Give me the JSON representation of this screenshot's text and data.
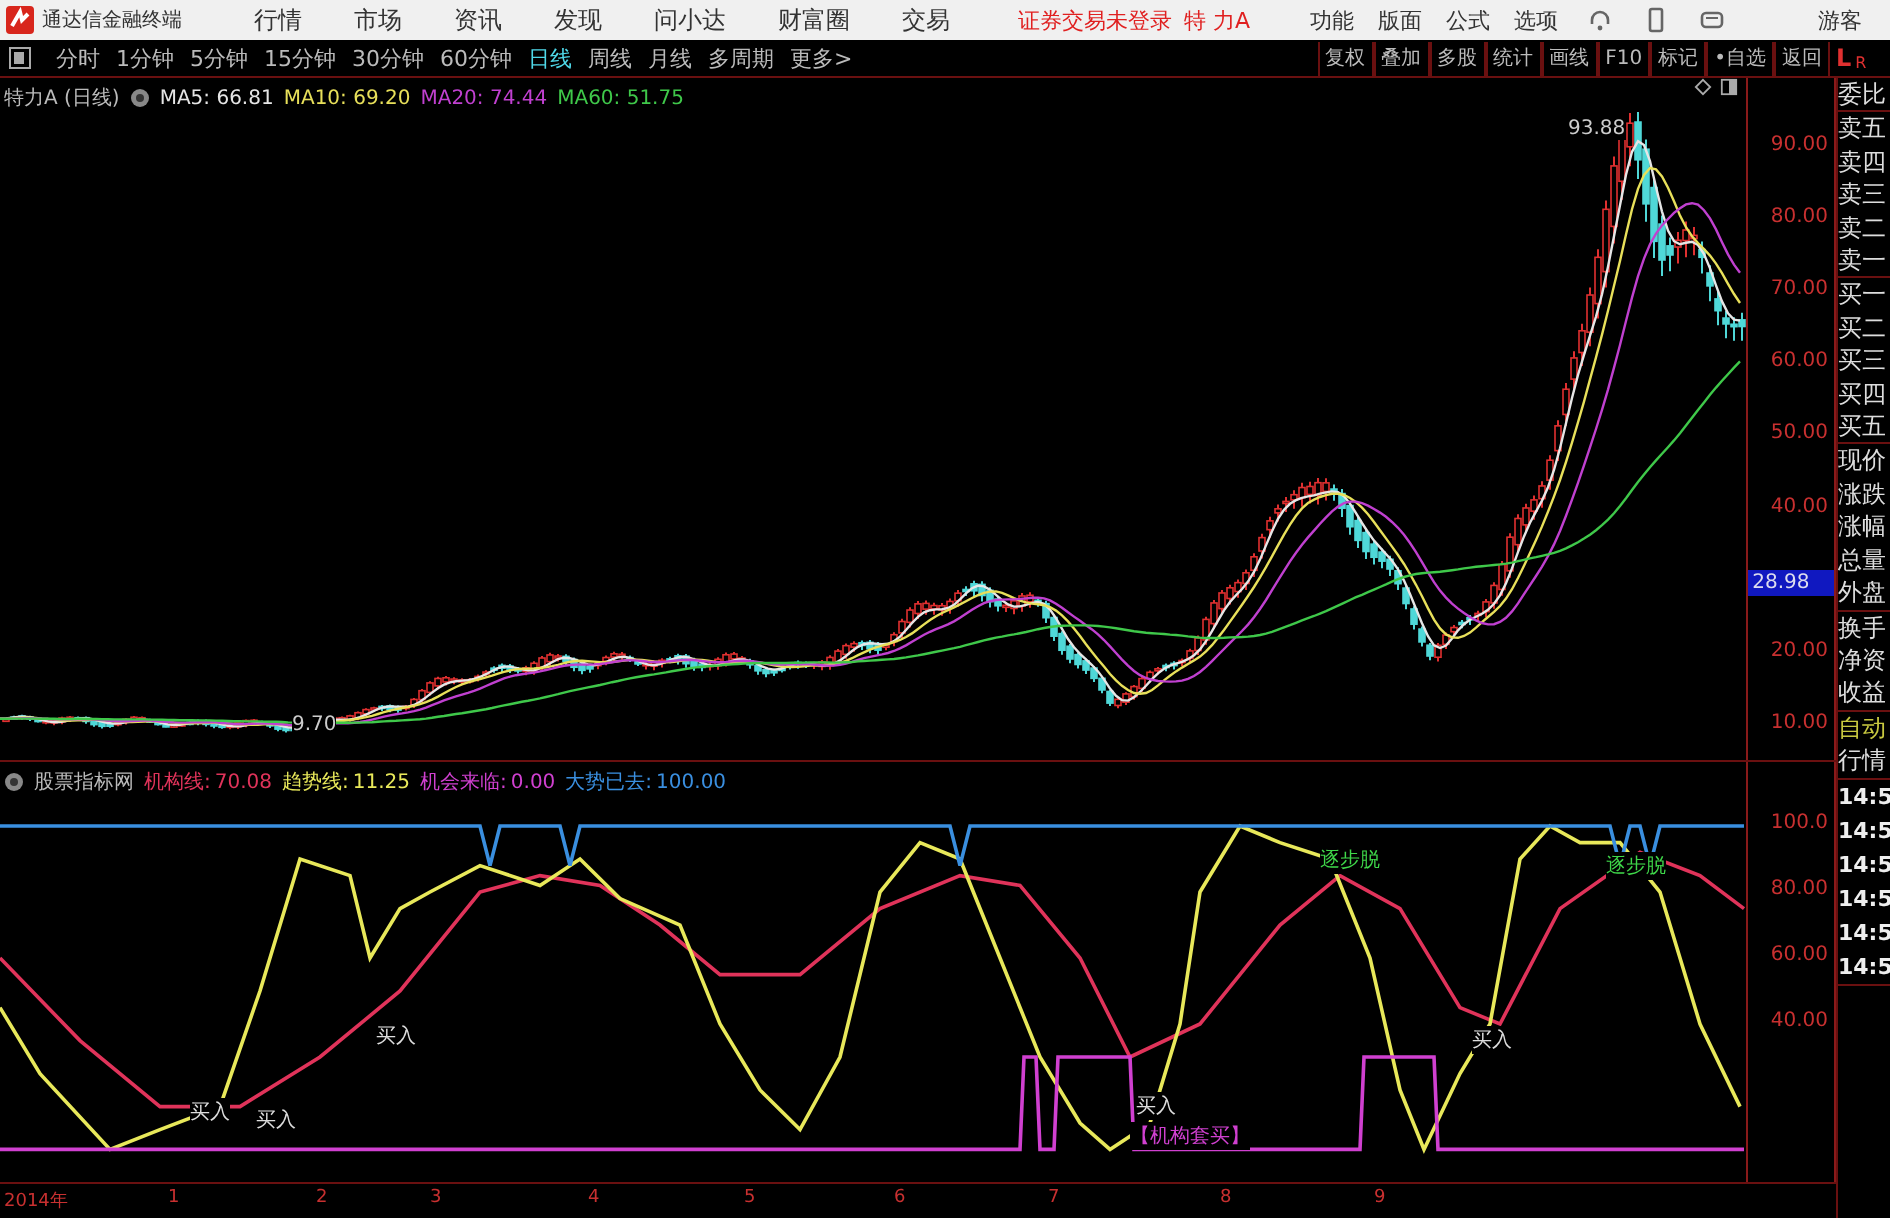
{
  "app_title": "通达信金融终端",
  "menu": [
    "行情",
    "市场",
    "资讯",
    "发现",
    "问小达",
    "财富圈",
    "交易"
  ],
  "login_notice": "证券交易未登录",
  "stock_name": "特 力A",
  "top_actions": [
    "功能",
    "版面",
    "公式",
    "选项"
  ],
  "user": "游客",
  "periods": [
    {
      "label": "分时",
      "selected": false
    },
    {
      "label": "1分钟",
      "selected": false
    },
    {
      "label": "5分钟",
      "selected": false
    },
    {
      "label": "15分钟",
      "selected": false
    },
    {
      "label": "30分钟",
      "selected": false
    },
    {
      "label": "60分钟",
      "selected": false
    },
    {
      "label": "日线",
      "selected": true
    },
    {
      "label": "周线",
      "selected": false
    },
    {
      "label": "月线",
      "selected": false
    },
    {
      "label": "多周期",
      "selected": false
    }
  ],
  "more": "更多>",
  "tools": [
    "复权",
    "叠加",
    "多股",
    "统计",
    "画线",
    "F10",
    "标记",
    "•自选",
    "返回"
  ],
  "corner": [
    "L",
    "R"
  ],
  "main_chart": {
    "title": "特力A (日线)",
    "ma": [
      {
        "label": "MA5: 66.81",
        "color": "#e6e6e6"
      },
      {
        "label": "MA10: 69.20",
        "color": "#e8e05a"
      },
      {
        "label": "MA20: 74.44",
        "color": "#c040d0"
      },
      {
        "label": "MA60: 51.75",
        "color": "#3fc84a"
      }
    ],
    "price_labels": [
      "90.00",
      "80.00",
      "70.00",
      "60.00",
      "50.00",
      "40.00",
      "20.00",
      "10.00"
    ],
    "current_price": "28.98",
    "high_label": "93.88",
    "low_label": "9.70"
  },
  "indicator": {
    "source": "股票指标网",
    "series": [
      {
        "label": "机构线:",
        "value": "70.08",
        "color": "#e0335a"
      },
      {
        "label": "趋势线:",
        "value": "11.25",
        "color": "#e8e85a"
      },
      {
        "label": "机会来临:",
        "value": "0.00",
        "color": "#d040d0"
      },
      {
        "label": "大势已去:",
        "value": "100.00",
        "color": "#3a8fe0"
      }
    ],
    "axis_labels": [
      "100.0",
      "80.00",
      "60.00",
      "40.00"
    ],
    "annotations": [
      {
        "text": "买入",
        "kind": "buy"
      },
      {
        "text": "买入",
        "kind": "buy"
      },
      {
        "text": "买入",
        "kind": "buy"
      },
      {
        "text": "买入",
        "kind": "buy"
      },
      {
        "text": "买入",
        "kind": "buy"
      },
      {
        "text": "逐步脱",
        "kind": "exit"
      },
      {
        "text": "逐步脱",
        "kind": "exit"
      },
      {
        "text": "【机构套买】",
        "kind": "signal"
      }
    ]
  },
  "x_axis": [
    "2014年",
    "1",
    "2",
    "3",
    "4",
    "5",
    "6",
    "7",
    "8",
    "9"
  ],
  "quote_panel": {
    "groups": [
      {
        "kind": "plain",
        "items": [
          "委比"
        ]
      },
      {
        "kind": "plain",
        "items": [
          "卖五",
          "卖四",
          "卖三",
          "卖二",
          "卖一"
        ]
      },
      {
        "kind": "plain",
        "items": [
          "买一",
          "买二",
          "买三",
          "买四",
          "买五"
        ]
      },
      {
        "kind": "plain",
        "items": [
          "现价",
          "涨跌",
          "涨幅",
          "总量",
          "外盘"
        ]
      },
      {
        "kind": "plain",
        "items": [
          "换手",
          "净资",
          "收益"
        ]
      },
      {
        "kind": "status",
        "items": [
          "自动",
          "行情"
        ]
      },
      {
        "kind": "time",
        "items": [
          "14:5",
          "14:5",
          "14:5",
          "14:5",
          "14:5",
          "14:5"
        ]
      }
    ]
  }
}
